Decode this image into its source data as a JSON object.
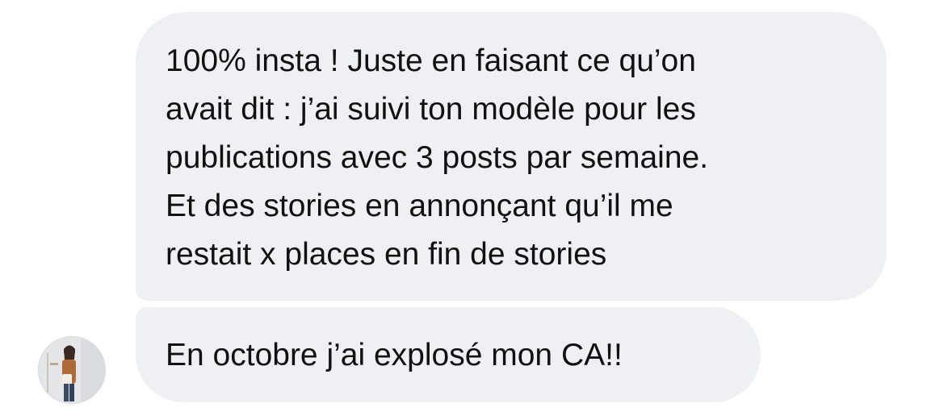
{
  "conversation": {
    "messages": [
      {
        "lines": [
          "100% insta ! Juste en faisant ce qu’on",
          "avait dit : j’ai suivi ton modèle pour les",
          "publications avec 3 posts par semaine.",
          "Et des stories en annonçant qu’il me",
          "restait x places en fin de stories"
        ]
      },
      {
        "lines": [
          "En octobre j’ai explosé mon CA!!"
        ]
      }
    ]
  },
  "colors": {
    "bubble_background": "#eff0f3",
    "text": "#111111",
    "page_background": "#ffffff"
  }
}
